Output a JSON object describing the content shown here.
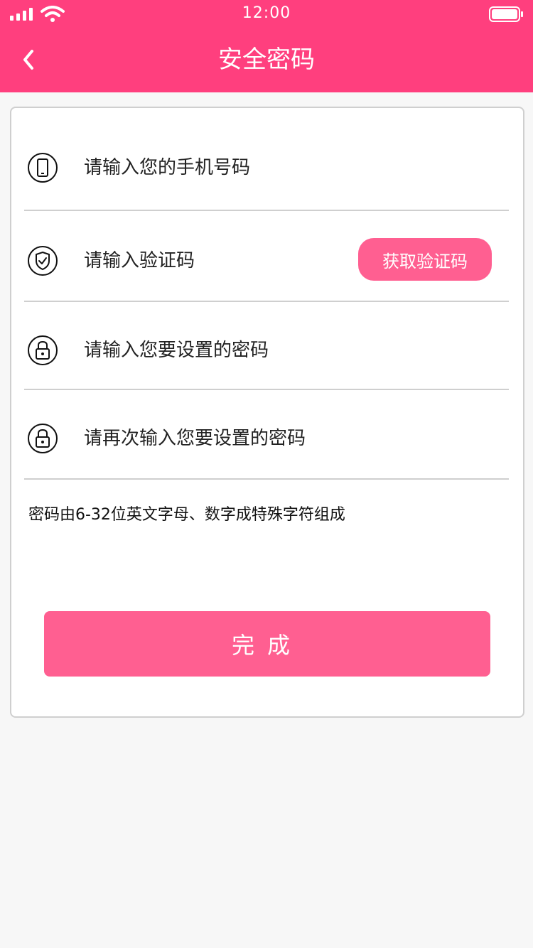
{
  "status_bar": {
    "time": "12:00"
  },
  "header": {
    "title": "安全密码",
    "back_icon": "chevron-left-icon",
    "color": "#ff3f7e"
  },
  "form": {
    "phone": {
      "icon": "phone-icon",
      "placeholder": "请输入您的手机号码"
    },
    "code": {
      "icon": "shield-icon",
      "placeholder": "请输入验证码",
      "button_label": "获取验证码"
    },
    "password": {
      "icon": "lock-icon",
      "placeholder": "请输入您要设置的密码"
    },
    "confirm_password": {
      "icon": "lock-icon",
      "placeholder": "请再次输入您要设置的密码"
    },
    "hint": "密码由6-32位英文字母、数字成特殊字符组成"
  },
  "actions": {
    "done_label": "完成",
    "accent": "#ff5f91"
  }
}
